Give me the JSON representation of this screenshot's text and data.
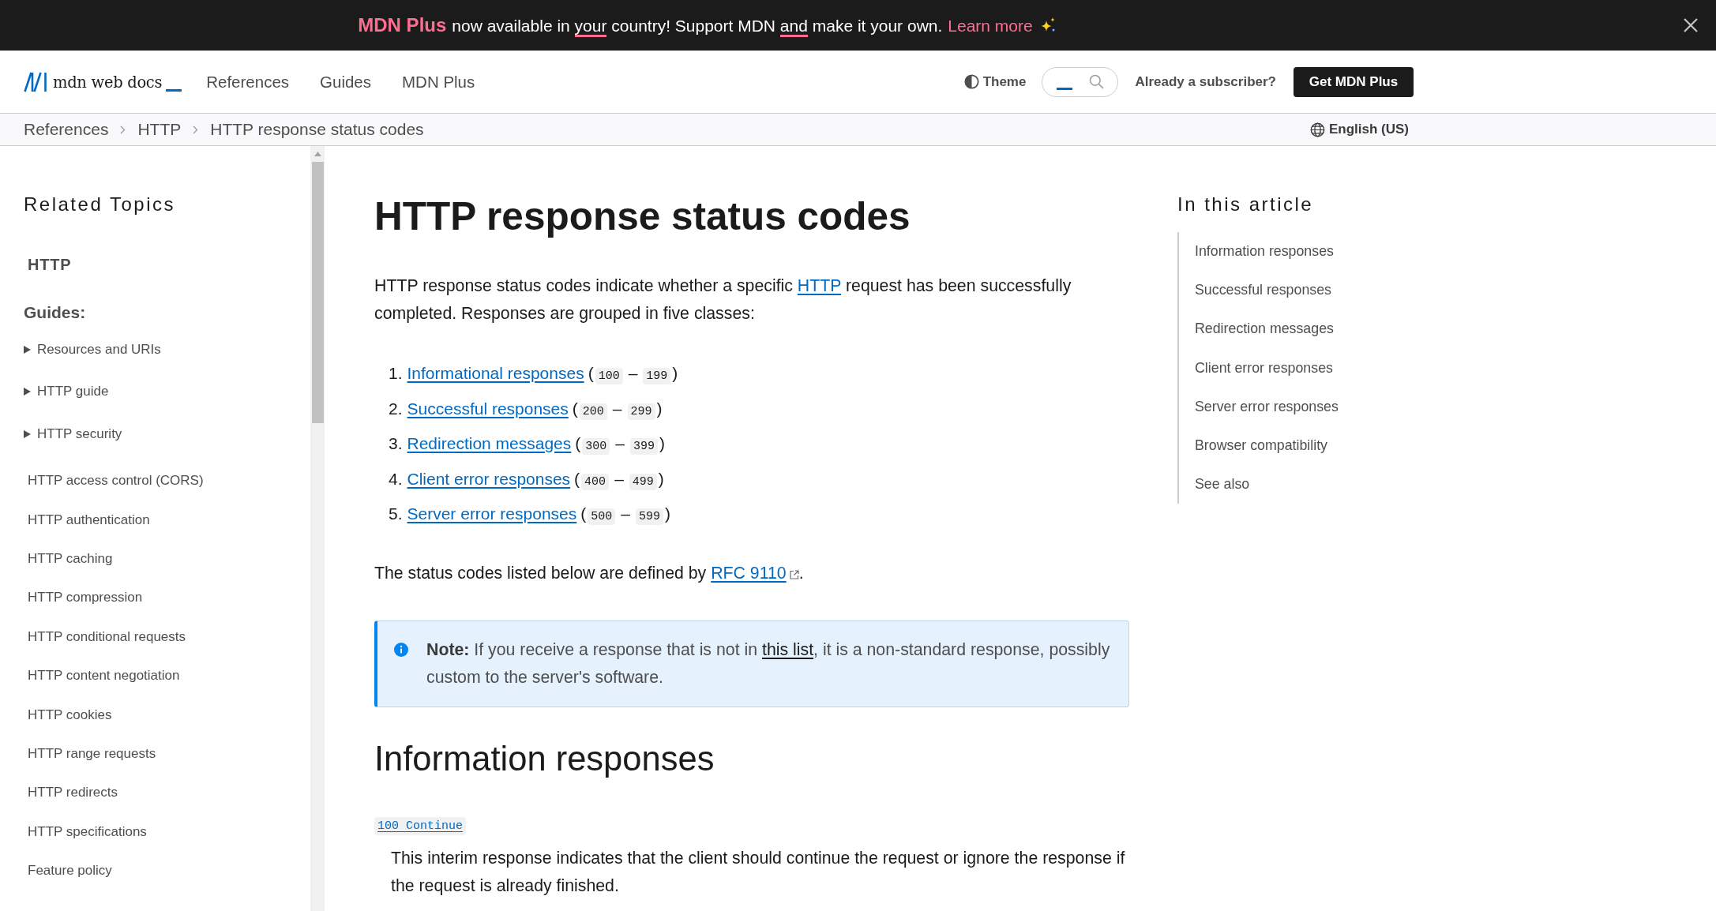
{
  "banner": {
    "brand": "MDN Plus",
    "segments": [
      {
        "text": "now available in ",
        "underlined": false
      },
      {
        "text": "your",
        "underlined": true
      },
      {
        "text": " country! Support MDN ",
        "underlined": false
      },
      {
        "text": "and",
        "underlined": true
      },
      {
        "text": " make it your own.",
        "underlined": false
      }
    ],
    "link": "Learn more"
  },
  "header": {
    "logo": "mdn web docs",
    "nav": [
      "References",
      "Guides",
      "MDN Plus"
    ],
    "theme": "Theme",
    "subscriber_link": "Already a subscriber?",
    "cta": "Get MDN Plus"
  },
  "breadcrumbs": {
    "items": [
      "References",
      "HTTP",
      "HTTP response status codes"
    ],
    "language": "English (US)"
  },
  "sidebar": {
    "title": "Related Topics",
    "section": "HTTP",
    "group": "Guides:",
    "items": [
      {
        "kind": "group",
        "label": "Resources and URIs",
        "expanded": false
      },
      {
        "kind": "group",
        "label": "HTTP guide",
        "expanded": false
      },
      {
        "kind": "group",
        "label": "HTTP security",
        "expanded": false
      },
      {
        "kind": "link",
        "label": "HTTP access control (CORS)"
      },
      {
        "kind": "link",
        "label": "HTTP authentication"
      },
      {
        "kind": "link",
        "label": "HTTP caching"
      },
      {
        "kind": "link",
        "label": "HTTP compression"
      },
      {
        "kind": "link",
        "label": "HTTP conditional requests"
      },
      {
        "kind": "link",
        "label": "HTTP content negotiation"
      },
      {
        "kind": "link",
        "label": "HTTP cookies"
      },
      {
        "kind": "link",
        "label": "HTTP range requests"
      },
      {
        "kind": "link",
        "label": "HTTP redirects"
      },
      {
        "kind": "link",
        "label": "HTTP specifications"
      },
      {
        "kind": "link",
        "label": "Feature policy"
      }
    ]
  },
  "article": {
    "title": "HTTP response status codes",
    "intro": {
      "before": "HTTP response status codes indicate whether a specific ",
      "link": "HTTP",
      "after": " request has been successfully completed. Responses are grouped in five classes:"
    },
    "classes": [
      {
        "number": "1.",
        "link": "Informational responses",
        "open": "(",
        "from": "100",
        "dash": "–",
        "to": "199",
        "close": ")"
      },
      {
        "number": "2.",
        "link": "Successful responses",
        "open": "(",
        "from": "200",
        "dash": "–",
        "to": "299",
        "close": ")"
      },
      {
        "number": "3.",
        "link": "Redirection messages",
        "open": "(",
        "from": "300",
        "dash": "–",
        "to": "399",
        "close": ")"
      },
      {
        "number": "4.",
        "link": "Client error responses",
        "open": "(",
        "from": "400",
        "dash": "–",
        "to": "499",
        "close": ")"
      },
      {
        "number": "5.",
        "link": "Server error responses",
        "open": "(",
        "from": "500",
        "dash": "–",
        "to": "599",
        "close": ")"
      }
    ],
    "defined_by": {
      "before": "The status codes listed below are defined by ",
      "link": "RFC 9110",
      "after": "."
    },
    "note": {
      "label": "Note:",
      "before": " If you receive a response that is not in ",
      "link": "this list",
      "after": ", it is a non-standard response, possibly custom to the server's software."
    },
    "section": {
      "heading": "Information responses",
      "entries": [
        {
          "code": "100 Continue",
          "description": "This interim response indicates that the client should continue the request or ignore the response if the request is already finished."
        }
      ]
    }
  },
  "toc": {
    "title": "In this article",
    "items": [
      "Information responses",
      "Successful responses",
      "Redirection messages",
      "Client error responses",
      "Server error responses",
      "Browser compatibility",
      "See also"
    ]
  }
}
